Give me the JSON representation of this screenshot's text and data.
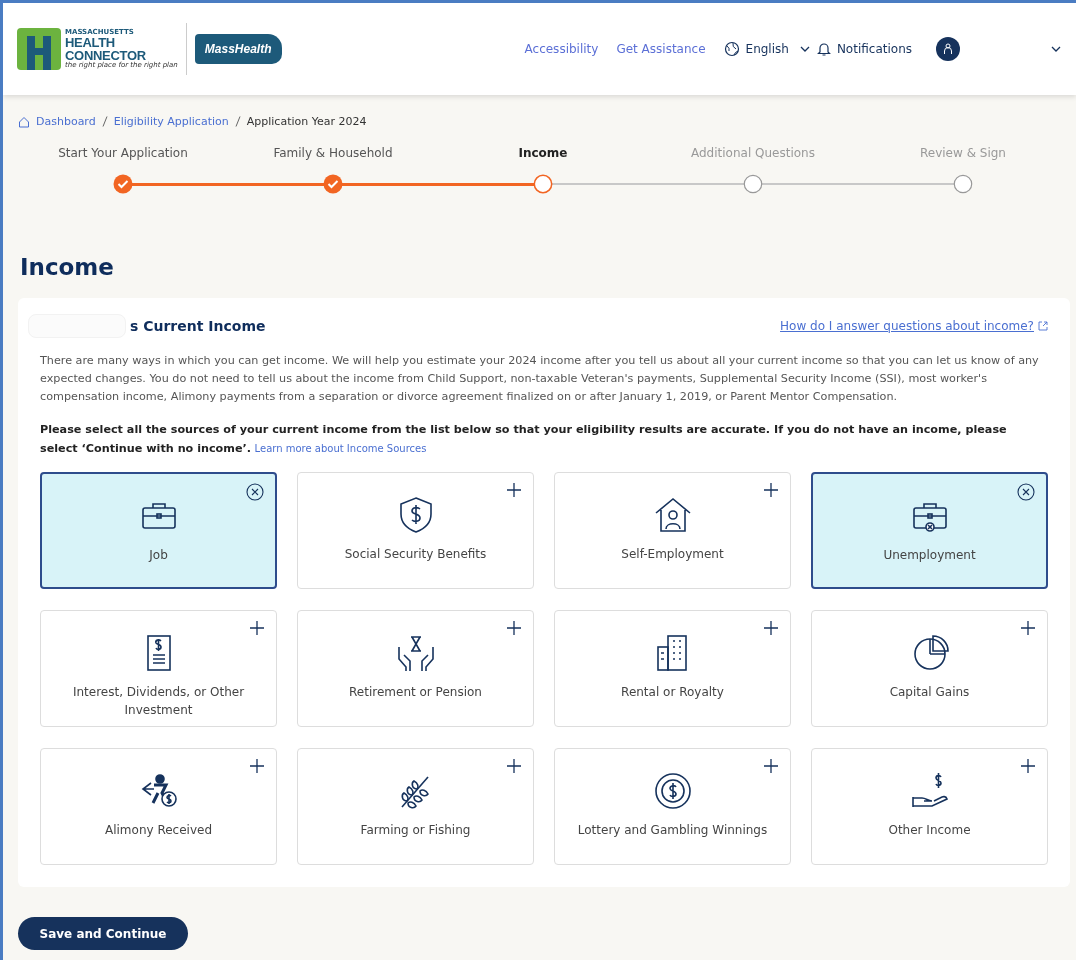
{
  "header": {
    "logo": {
      "state": "MASSACHUSETTS",
      "line1": "HEALTH",
      "line2": "CONNECTOR",
      "tagline": "the right place for the right plan"
    },
    "partner_logo": "MassHealth",
    "links": [
      "Accessibility",
      "Get Assistance"
    ],
    "language": "English",
    "notifications": "Notifications"
  },
  "breadcrumb": [
    "Dashboard",
    "Eligibility Application",
    "Application Year 2024"
  ],
  "steps": [
    {
      "label": "Start Your Application",
      "done": true,
      "selected": false
    },
    {
      "label": "Family & Household",
      "done": true,
      "selected": false
    },
    {
      "label": "Income",
      "done": false,
      "selected": true
    },
    {
      "label": "Additional Questions",
      "done": false,
      "selected": false
    },
    {
      "label": "Review & Sign",
      "done": false,
      "selected": false
    }
  ],
  "page_title": "Income",
  "section": {
    "title": "s Current Income",
    "help_link": "How do I answer questions about income?",
    "intro": "There are many ways in which you can get income. We will help you estimate your 2024 income after you tell us about all your current income so that you can let us know of any expected changes. You do not need to tell us about the income from Child Support, non-taxable Veteran's payments, Supplemental Security Income (SSI), most worker's compensation income, Alimony payments from a separation or divorce agreement finalized on or after January 1, 2019, or Parent Mentor Compensation.",
    "instruction": "Please select all the sources of your current income from the list below so that your eligibility results are accurate. If you do not have an income, please select ‘Continue with no income’.",
    "learn_more": "Learn more about Income Sources"
  },
  "income_sources": [
    {
      "label": "Job",
      "selected": true
    },
    {
      "label": "Social Security Benefits",
      "selected": false
    },
    {
      "label": "Self-Employment",
      "selected": false
    },
    {
      "label": "Unemployment",
      "selected": true
    },
    {
      "label": "Interest, Dividends, or Other Investment",
      "selected": false
    },
    {
      "label": "Retirement or Pension",
      "selected": false
    },
    {
      "label": "Rental or Royalty",
      "selected": false
    },
    {
      "label": "Capital Gains",
      "selected": false
    },
    {
      "label": "Alimony Received",
      "selected": false
    },
    {
      "label": "Farming or Fishing",
      "selected": false
    },
    {
      "label": "Lottery and Gambling Winnings",
      "selected": false
    },
    {
      "label": "Other Income",
      "selected": false
    }
  ],
  "primary_button": "Save and Continue"
}
